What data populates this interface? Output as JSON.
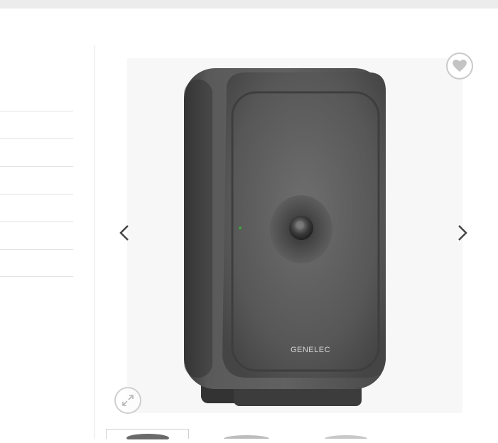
{
  "product": {
    "brand_label": "GENELEC",
    "image_icon": "studio-monitor-speaker"
  },
  "gallery": {
    "wishlist_icon": "heart-icon",
    "prev_icon": "chevron-left-icon",
    "next_icon": "chevron-right-icon",
    "zoom_icon": "expand-icon",
    "thumbnail_count": 3
  },
  "sidebar": {
    "row_count": 6
  }
}
